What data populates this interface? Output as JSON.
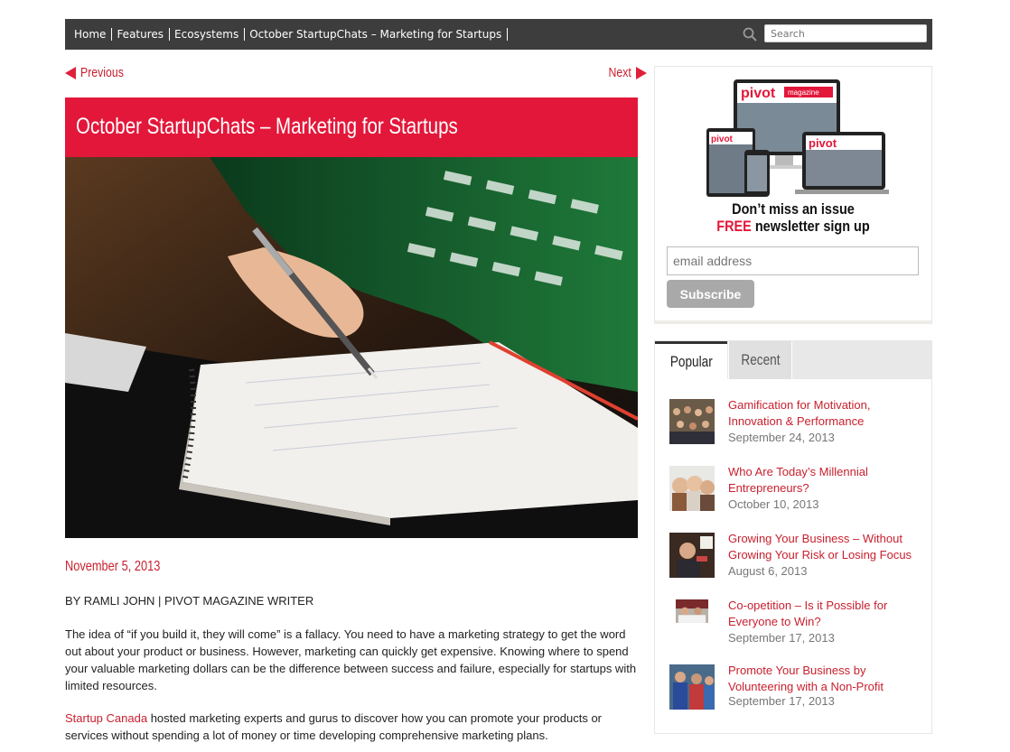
{
  "nav": {
    "breadcrumbs": [
      "Home",
      "Features",
      "Ecosystems",
      "October StartupChats – Marketing for Startups"
    ],
    "search_placeholder": "Search"
  },
  "pager": {
    "previous": "Previous",
    "next": "Next"
  },
  "article": {
    "title": "October StartupChats – Marketing for Startups",
    "date": "November 5, 2013",
    "byline": "BY RAMLI JOHN | PIVOT MAGAZINE WRITER",
    "para1": "The idea of “if you build it, they will come” is a fallacy. You need to have a marketing strategy to get the word out about your product or business. However, marketing can quickly get expensive. Knowing where to spend your valuable marketing dollars can be the difference between success and failure, especially for startups with limited resources.",
    "para2_link": "Startup Canada",
    "para2_rest": " hosted marketing experts and gurus to discover how you can promote your products or services without spending a lot of money or time developing comprehensive marketing plans."
  },
  "newsletter": {
    "brand": "pivot",
    "brand_sub": "magazine",
    "line1": "Don’t miss an issue",
    "free": "FREE",
    "line2_rest": " newsletter sign up",
    "email_placeholder": "email address",
    "button": "Subscribe"
  },
  "tabs": {
    "popular": "Popular",
    "recent": "Recent"
  },
  "posts": [
    {
      "title": "Gamification for Motivation, Innovation & Performance",
      "date": "September 24, 2013"
    },
    {
      "title": "Who Are Today’s Millennial Entrepreneurs?",
      "date": "October 10, 2013"
    },
    {
      "title": "Growing Your Business – Without Growing Your Risk or Losing Focus",
      "date": "August 6, 2013"
    },
    {
      "title": "Co-opetition – Is it Possible for Everyone to Win?",
      "date": "September 17, 2013"
    },
    {
      "title": "Promote Your Business by Volunteering with a Non-Profit",
      "date": "September 17, 2013"
    }
  ],
  "colors": {
    "accent": "#e3173a",
    "link": "#c8202e",
    "nav_bg": "#3d3d3d"
  }
}
